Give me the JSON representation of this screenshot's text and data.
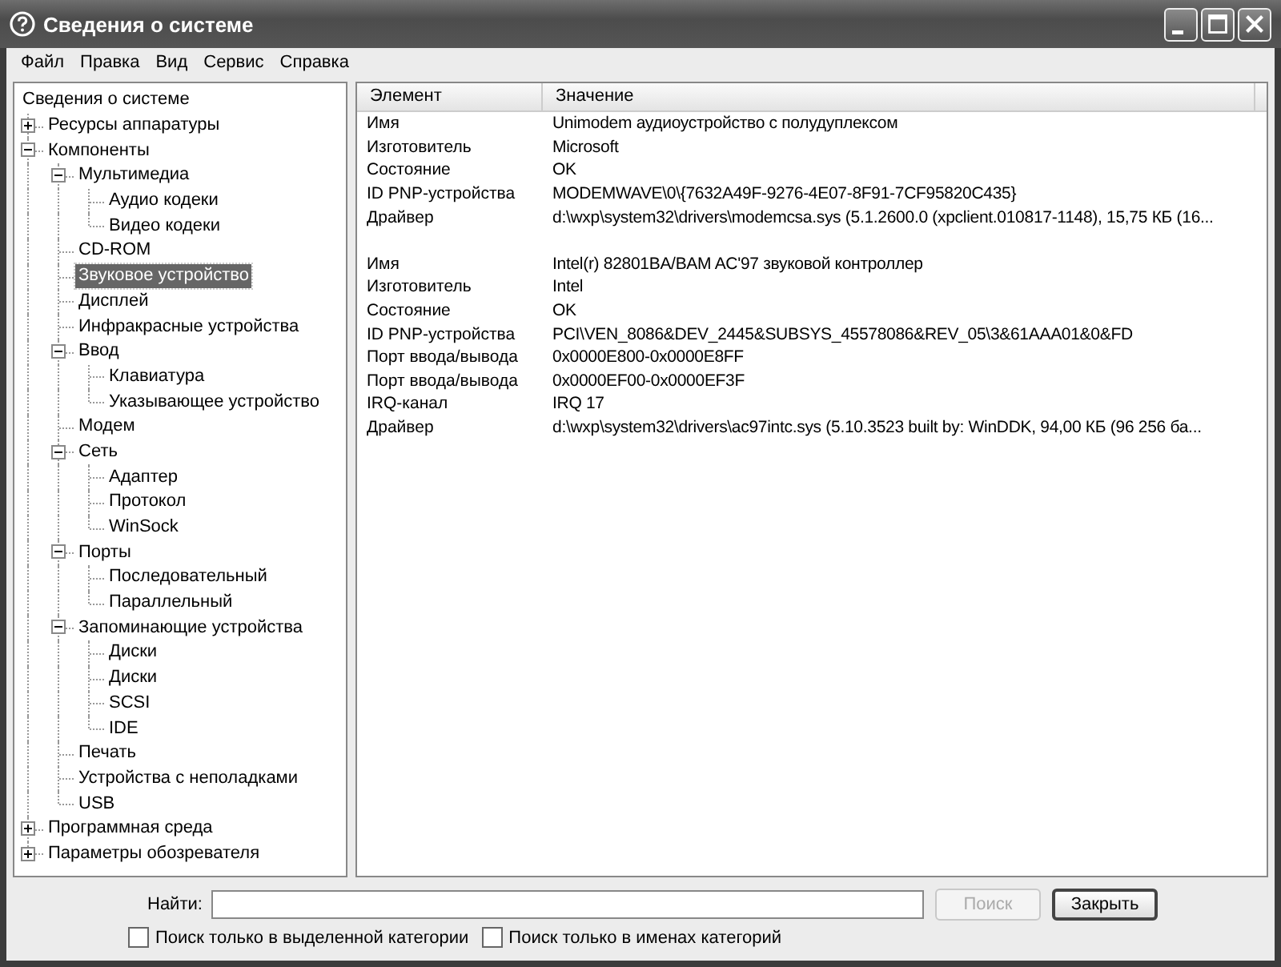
{
  "window": {
    "title": "Сведения о системе"
  },
  "menu": [
    {
      "label": "Файл"
    },
    {
      "label": "Правка"
    },
    {
      "label": "Вид"
    },
    {
      "label": "Сервис"
    },
    {
      "label": "Справка"
    }
  ],
  "tree": {
    "label": "Сведения о системе",
    "selected": false,
    "children": [
      {
        "label": "Ресурсы аппаратуры",
        "selected": false,
        "expanded": false
      },
      {
        "label": "Компоненты",
        "selected": false,
        "expanded": true,
        "children": [
          {
            "label": "Мультимедиа",
            "selected": false,
            "expanded": true,
            "children": [
              {
                "label": "Аудио кодеки",
                "selected": false
              },
              {
                "label": "Видео кодеки",
                "selected": false
              }
            ]
          },
          {
            "label": "CD-ROM",
            "selected": false
          },
          {
            "label": "Звуковое устройство",
            "selected": true
          },
          {
            "label": "Дисплей",
            "selected": false
          },
          {
            "label": "Инфракрасные устройства",
            "selected": false
          },
          {
            "label": "Ввод",
            "selected": false,
            "expanded": true,
            "children": [
              {
                "label": "Клавиатура",
                "selected": false
              },
              {
                "label": "Указывающее устройство",
                "selected": false
              }
            ]
          },
          {
            "label": "Модем",
            "selected": false
          },
          {
            "label": "Сеть",
            "selected": false,
            "expanded": true,
            "children": [
              {
                "label": "Адаптер",
                "selected": false
              },
              {
                "label": "Протокол",
                "selected": false
              },
              {
                "label": "WinSock",
                "selected": false
              }
            ]
          },
          {
            "label": "Порты",
            "selected": false,
            "expanded": true,
            "children": [
              {
                "label": "Последовательный",
                "selected": false
              },
              {
                "label": "Параллельный",
                "selected": false
              }
            ]
          },
          {
            "label": "Запоминающие устройства",
            "selected": false,
            "expanded": true,
            "children": [
              {
                "label": "Диски",
                "selected": false
              },
              {
                "label": "Диски",
                "selected": false
              },
              {
                "label": "SCSI",
                "selected": false
              },
              {
                "label": "IDE",
                "selected": false
              }
            ]
          },
          {
            "label": "Печать",
            "selected": false
          },
          {
            "label": "Устройства с неполадками",
            "selected": false
          },
          {
            "label": "USB",
            "selected": false
          }
        ]
      },
      {
        "label": "Программная среда",
        "selected": false,
        "expanded": false
      },
      {
        "label": "Параметры обозревателя",
        "selected": false,
        "expanded": false
      }
    ]
  },
  "table": {
    "columns": [
      "Элемент",
      "Значение"
    ],
    "groups": [
      {
        "rows": [
          [
            "Имя",
            "Unimodem аудиоустройство с полудуплексом"
          ],
          [
            "Изготовитель",
            "Microsoft"
          ],
          [
            "Состояние",
            "OK"
          ],
          [
            "ID PNP-устройства",
            "MODEMWAVE\\0\\{7632A49F-9276-4E07-8F91-7CF95820C435}"
          ],
          [
            "Драйвер",
            "d:\\wxp\\system32\\drivers\\modemcsa.sys (5.1.2600.0 (xpclient.010817-1148), 15,75 КБ (16..."
          ]
        ]
      },
      {
        "rows": [
          [
            "Имя",
            "Intel(r) 82801BA/BAM AC'97 звуковой контроллер"
          ],
          [
            "Изготовитель",
            "Intel"
          ],
          [
            "Состояние",
            "OK"
          ],
          [
            "ID PNP-устройства",
            "PCI\\VEN_8086&DEV_2445&SUBSYS_45578086&REV_05\\3&61AAA01&0&FD"
          ],
          [
            "Порт ввода/вывода",
            "0x0000E800-0x0000E8FF"
          ],
          [
            "Порт ввода/вывода",
            "0x0000EF00-0x0000EF3F"
          ],
          [
            "IRQ-канал",
            "IRQ 17"
          ],
          [
            "Драйвер",
            "d:\\wxp\\system32\\drivers\\ac97intc.sys (5.10.3523 built by: WinDDK, 94,00 КБ (96 256 ба..."
          ]
        ]
      }
    ]
  },
  "search": {
    "label": "Найти:",
    "find_button": {
      "label": "Поиск",
      "disabled": true
    },
    "close_button": {
      "label": "Закрыть",
      "disabled": false
    },
    "options": [
      {
        "label": "Поиск только в выделенной категории",
        "checked": false
      },
      {
        "label": "Поиск только в именах категорий",
        "checked": false
      }
    ]
  }
}
